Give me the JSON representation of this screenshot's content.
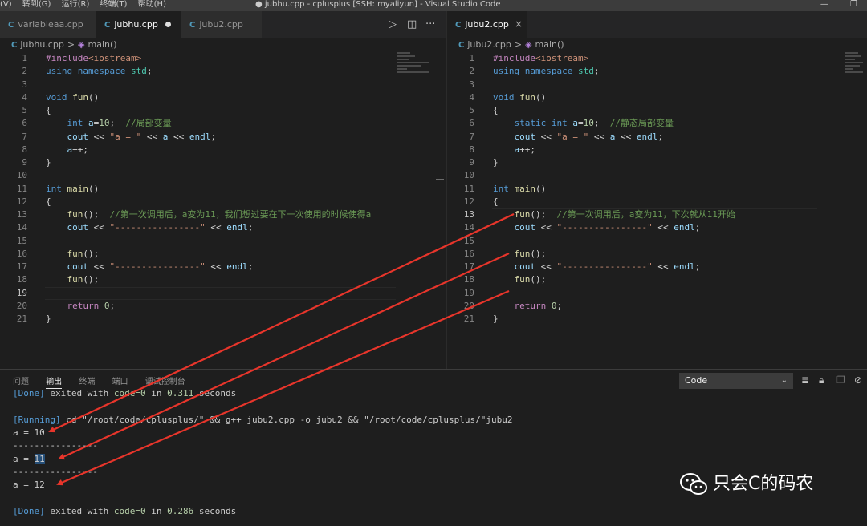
{
  "titlebar": {
    "menus": [
      "(V)",
      "转到(G)",
      "运行(R)",
      "终端(T)",
      "帮助(H)"
    ],
    "title": "● jubhu.cpp - cplusplus [SSH: myaliyun] - Visual Studio Code",
    "min_glyph": "—",
    "max_glyph": "❐"
  },
  "left_editor": {
    "tabs": [
      {
        "label": "variableaa.cpp",
        "icon": "C++",
        "active": false
      },
      {
        "label": "jubhu.cpp",
        "icon": "C++",
        "active": true,
        "dirty": true
      },
      {
        "label": "jubu2.cpp",
        "icon": "C++",
        "active": false
      }
    ],
    "breadcrumb": {
      "file": "jubhu.cpp",
      "sep": ">",
      "symbol": "main()"
    },
    "lines": [
      {
        "n": "1",
        "tokens": [
          [
            "#include",
            "pp"
          ],
          [
            "<iostream>",
            "st"
          ]
        ]
      },
      {
        "n": "2",
        "tokens": [
          [
            "using ",
            "kw"
          ],
          [
            "namespace ",
            "kw"
          ],
          [
            "std",
            "ns"
          ],
          [
            ";",
            "pl"
          ]
        ]
      },
      {
        "n": "3",
        "tokens": []
      },
      {
        "n": "4",
        "tokens": [
          [
            "void ",
            "ty"
          ],
          [
            "fun",
            "fn"
          ],
          [
            "()",
            "pl"
          ]
        ]
      },
      {
        "n": "5",
        "tokens": [
          [
            "{",
            "pl"
          ]
        ]
      },
      {
        "n": "6",
        "tokens": [
          [
            "    ",
            "pl"
          ],
          [
            "int ",
            "ty"
          ],
          [
            "a",
            "id"
          ],
          [
            "=",
            "pl"
          ],
          [
            "10",
            "nm"
          ],
          [
            ";  ",
            "pl"
          ],
          [
            "//局部变量",
            "cm"
          ]
        ]
      },
      {
        "n": "7",
        "tokens": [
          [
            "    ",
            "pl"
          ],
          [
            "cout ",
            "id"
          ],
          [
            "<< ",
            "pl"
          ],
          [
            "\"a = \" ",
            "st"
          ],
          [
            "<< ",
            "pl"
          ],
          [
            "a ",
            "id"
          ],
          [
            "<< ",
            "pl"
          ],
          [
            "endl",
            "id"
          ],
          [
            ";",
            "pl"
          ]
        ]
      },
      {
        "n": "8",
        "tokens": [
          [
            "    ",
            "pl"
          ],
          [
            "a",
            "id"
          ],
          [
            "++;",
            "pl"
          ]
        ]
      },
      {
        "n": "9",
        "tokens": [
          [
            "}",
            "pl"
          ]
        ]
      },
      {
        "n": "10",
        "tokens": []
      },
      {
        "n": "11",
        "tokens": [
          [
            "int ",
            "ty"
          ],
          [
            "main",
            "fn"
          ],
          [
            "()",
            "pl"
          ]
        ]
      },
      {
        "n": "12",
        "tokens": [
          [
            "{",
            "pl"
          ]
        ]
      },
      {
        "n": "13",
        "tokens": [
          [
            "    ",
            "pl"
          ],
          [
            "fun",
            "fn"
          ],
          [
            "();  ",
            "pl"
          ],
          [
            "//第一次调用后，a变为11，我们想过要在下一次使用的时候使得a",
            "cm"
          ]
        ]
      },
      {
        "n": "14",
        "tokens": [
          [
            "    ",
            "pl"
          ],
          [
            "cout ",
            "id"
          ],
          [
            "<< ",
            "pl"
          ],
          [
            "\"----------------\" ",
            "st"
          ],
          [
            "<< ",
            "pl"
          ],
          [
            "endl",
            "id"
          ],
          [
            ";",
            "pl"
          ]
        ]
      },
      {
        "n": "15",
        "tokens": []
      },
      {
        "n": "16",
        "tokens": [
          [
            "    ",
            "pl"
          ],
          [
            "fun",
            "fn"
          ],
          [
            "();",
            "pl"
          ]
        ]
      },
      {
        "n": "17",
        "tokens": [
          [
            "    ",
            "pl"
          ],
          [
            "cout ",
            "id"
          ],
          [
            "<< ",
            "pl"
          ],
          [
            "\"----------------\" ",
            "st"
          ],
          [
            "<< ",
            "pl"
          ],
          [
            "endl",
            "id"
          ],
          [
            ";",
            "pl"
          ]
        ]
      },
      {
        "n": "18",
        "tokens": [
          [
            "    ",
            "pl"
          ],
          [
            "fun",
            "fn"
          ],
          [
            "();",
            "pl"
          ]
        ]
      },
      {
        "n": "19",
        "tokens": [],
        "current": true
      },
      {
        "n": "20",
        "tokens": [
          [
            "    ",
            "pl"
          ],
          [
            "return ",
            "pp"
          ],
          [
            "0",
            "nm"
          ],
          [
            ";",
            "pl"
          ]
        ]
      },
      {
        "n": "21",
        "tokens": [
          [
            "}",
            "pl"
          ]
        ]
      }
    ]
  },
  "right_editor": {
    "tabs": [
      {
        "label": "jubu2.cpp",
        "icon": "C++",
        "active": true
      }
    ],
    "close_glyph": "×",
    "breadcrumb": {
      "file": "jubu2.cpp",
      "sep": ">",
      "symbol": "main()"
    },
    "lines": [
      {
        "n": "1",
        "tokens": [
          [
            "#include",
            "pp"
          ],
          [
            "<iostream>",
            "st"
          ]
        ]
      },
      {
        "n": "2",
        "tokens": [
          [
            "using ",
            "kw"
          ],
          [
            "namespace ",
            "kw"
          ],
          [
            "std",
            "ns"
          ],
          [
            ";",
            "pl"
          ]
        ]
      },
      {
        "n": "3",
        "tokens": []
      },
      {
        "n": "4",
        "tokens": [
          [
            "void ",
            "ty"
          ],
          [
            "fun",
            "fn"
          ],
          [
            "()",
            "pl"
          ]
        ]
      },
      {
        "n": "5",
        "tokens": [
          [
            "{",
            "pl"
          ]
        ]
      },
      {
        "n": "6",
        "tokens": [
          [
            "    ",
            "pl"
          ],
          [
            "static ",
            "ty"
          ],
          [
            "int ",
            "ty"
          ],
          [
            "a",
            "id"
          ],
          [
            "=",
            "pl"
          ],
          [
            "10",
            "nm"
          ],
          [
            ";  ",
            "pl"
          ],
          [
            "//静态局部变量",
            "cm"
          ]
        ]
      },
      {
        "n": "7",
        "tokens": [
          [
            "    ",
            "pl"
          ],
          [
            "cout ",
            "id"
          ],
          [
            "<< ",
            "pl"
          ],
          [
            "\"a = \" ",
            "st"
          ],
          [
            "<< ",
            "pl"
          ],
          [
            "a ",
            "id"
          ],
          [
            "<< ",
            "pl"
          ],
          [
            "endl",
            "id"
          ],
          [
            ";",
            "pl"
          ]
        ]
      },
      {
        "n": "8",
        "tokens": [
          [
            "    ",
            "pl"
          ],
          [
            "a",
            "id"
          ],
          [
            "++;",
            "pl"
          ]
        ]
      },
      {
        "n": "9",
        "tokens": [
          [
            "}",
            "pl"
          ]
        ]
      },
      {
        "n": "10",
        "tokens": []
      },
      {
        "n": "11",
        "tokens": [
          [
            "int ",
            "ty"
          ],
          [
            "main",
            "fn"
          ],
          [
            "()",
            "pl"
          ]
        ]
      },
      {
        "n": "12",
        "tokens": [
          [
            "{",
            "pl"
          ]
        ]
      },
      {
        "n": "13",
        "tokens": [
          [
            "    ",
            "pl"
          ],
          [
            "fun",
            "fn"
          ],
          [
            "();  ",
            "pl"
          ],
          [
            "//第一次调用后，a变为11，下次就从11开始",
            "cm"
          ]
        ],
        "current": true
      },
      {
        "n": "14",
        "tokens": [
          [
            "    ",
            "pl"
          ],
          [
            "cout ",
            "id"
          ],
          [
            "<< ",
            "pl"
          ],
          [
            "\"----------------\" ",
            "st"
          ],
          [
            "<< ",
            "pl"
          ],
          [
            "endl",
            "id"
          ],
          [
            ";",
            "pl"
          ]
        ]
      },
      {
        "n": "15",
        "tokens": []
      },
      {
        "n": "16",
        "tokens": [
          [
            "    ",
            "pl"
          ],
          [
            "fun",
            "fn"
          ],
          [
            "();",
            "pl"
          ]
        ]
      },
      {
        "n": "17",
        "tokens": [
          [
            "    ",
            "pl"
          ],
          [
            "cout ",
            "id"
          ],
          [
            "<< ",
            "pl"
          ],
          [
            "\"----------------\" ",
            "st"
          ],
          [
            "<< ",
            "pl"
          ],
          [
            "endl",
            "id"
          ],
          [
            ";",
            "pl"
          ]
        ]
      },
      {
        "n": "18",
        "tokens": [
          [
            "    ",
            "pl"
          ],
          [
            "fun",
            "fn"
          ],
          [
            "();",
            "pl"
          ]
        ]
      },
      {
        "n": "19",
        "tokens": []
      },
      {
        "n": "20",
        "tokens": [
          [
            "    ",
            "pl"
          ],
          [
            "return ",
            "pp"
          ],
          [
            "0",
            "nm"
          ],
          [
            ";",
            "pl"
          ]
        ]
      },
      {
        "n": "21",
        "tokens": [
          [
            "}",
            "pl"
          ]
        ]
      }
    ]
  },
  "panel": {
    "tabs": [
      {
        "label": "问题",
        "active": false
      },
      {
        "label": "输出",
        "active": true
      },
      {
        "label": "终端",
        "active": false
      },
      {
        "label": "端口",
        "active": false
      },
      {
        "label": "调试控制台",
        "active": false
      }
    ],
    "output_source": "Code",
    "chevron": "⌄",
    "output_lines": [
      {
        "tokens": [
          [
            "[Done] ",
            "tag"
          ],
          [
            "exited with ",
            "txt"
          ],
          [
            "code=0 ",
            "code"
          ],
          [
            "in ",
            "txt"
          ],
          [
            "0.311 ",
            "num"
          ],
          [
            "seconds",
            "txt"
          ]
        ]
      },
      {
        "tokens": []
      },
      {
        "tokens": [
          [
            "[Running] ",
            "tag"
          ],
          [
            "cd \"/root/code/cplusplus/\" && g++ jubu2.cpp -o jubu2 && \"/root/code/cplusplus/\"jubu2",
            "txt"
          ]
        ]
      },
      {
        "tokens": [
          [
            "a = 10",
            "txt"
          ]
        ]
      },
      {
        "tokens": [
          [
            "----------------",
            "txt"
          ]
        ]
      },
      {
        "tokens": [
          [
            "a = ",
            "txt"
          ],
          [
            "11",
            "sel"
          ]
        ]
      },
      {
        "tokens": [
          [
            "----------------",
            "txt"
          ]
        ]
      },
      {
        "tokens": [
          [
            "a = 12",
            "txt"
          ]
        ]
      },
      {
        "tokens": []
      },
      {
        "tokens": [
          [
            "[Done] ",
            "tag"
          ],
          [
            "exited with ",
            "txt"
          ],
          [
            "code=0 ",
            "code"
          ],
          [
            "in ",
            "txt"
          ],
          [
            "0.286 ",
            "num"
          ],
          [
            "seconds",
            "txt"
          ]
        ]
      }
    ]
  },
  "watermark": {
    "text": "只会C的码农"
  },
  "colors": {
    "editor_bg": "#1e1e1e",
    "arrow": "#e8352b",
    "keyword": "#569cd6",
    "comment": "#6a9955",
    "string": "#ce9178"
  },
  "icons": [
    "split-editor-icon",
    "run-icon",
    "more-icon",
    "close-icon",
    "chevron-down-icon",
    "list-filter-icon",
    "lock-icon",
    "copy-icon",
    "clear-output-icon",
    "wechat-icon",
    "cube-icon"
  ]
}
